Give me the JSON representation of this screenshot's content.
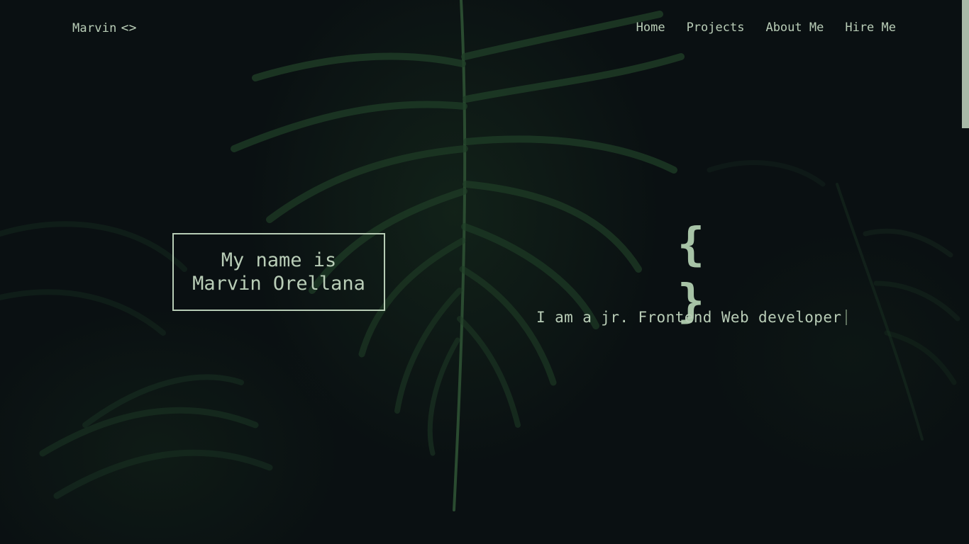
{
  "nav": {
    "logo_text": "Marvin",
    "logo_icon": "<>",
    "links": [
      {
        "label": "Home"
      },
      {
        "label": "Projects"
      },
      {
        "label": "About Me"
      },
      {
        "label": "Hire Me"
      }
    ]
  },
  "hero": {
    "name_line1": "My name is",
    "name_line2": "Marvin Orellana",
    "braces": "{ }",
    "tagline": "I am a jr. Frontend Web developer"
  },
  "theme": {
    "background": "#0a1012",
    "text": "#b9cdb7",
    "accent": "#a7c3a6",
    "foliage": "#1d3a24"
  },
  "icons": {
    "logo": "code-brackets-icon",
    "braces": "curly-braces-icon"
  }
}
